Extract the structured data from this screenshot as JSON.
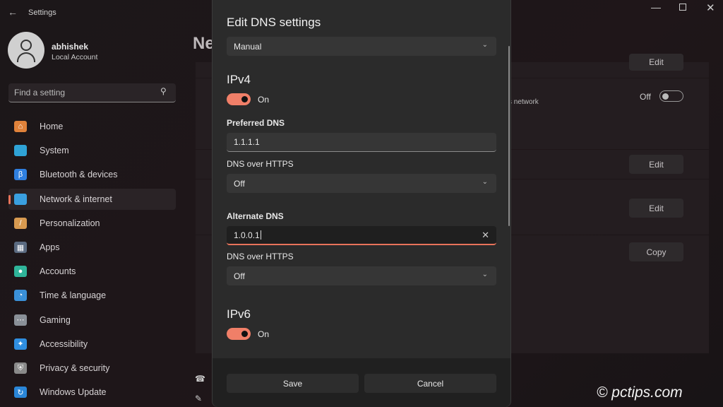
{
  "window": {
    "title": "Settings",
    "controls": [
      "minimize",
      "maximize",
      "close"
    ]
  },
  "profile": {
    "name": "abhishek",
    "account_type": "Local Account"
  },
  "search": {
    "placeholder": "Find a setting"
  },
  "sidebar": {
    "items": [
      {
        "label": "Home",
        "icon": "home-icon",
        "color": "#e0823a"
      },
      {
        "label": "System",
        "icon": "monitor-icon",
        "color": "#2fa3d6"
      },
      {
        "label": "Bluetooth & devices",
        "icon": "bluetooth-icon",
        "color": "#2f7fe0"
      },
      {
        "label": "Network & internet",
        "icon": "wifi-icon",
        "color": "#3aa0e0",
        "selected": true
      },
      {
        "label": "Personalization",
        "icon": "brush-icon",
        "color": "#d89a50"
      },
      {
        "label": "Apps",
        "icon": "apps-icon",
        "color": "#5a6a80"
      },
      {
        "label": "Accounts",
        "icon": "person-icon",
        "color": "#2fb59a"
      },
      {
        "label": "Time & language",
        "icon": "globe-clock-icon",
        "color": "#3a90d8"
      },
      {
        "label": "Gaming",
        "icon": "gamepad-icon",
        "color": "#8a9098"
      },
      {
        "label": "Accessibility",
        "icon": "accessibility-icon",
        "color": "#2f8ee0"
      },
      {
        "label": "Privacy & security",
        "icon": "shield-icon",
        "color": "#8a8a8a"
      },
      {
        "label": "Windows Update",
        "icon": "update-icon",
        "color": "#2a86d8"
      }
    ]
  },
  "background": {
    "page_title_partial": "Ne",
    "row_text_partial": "s network",
    "toggle_label": "Off",
    "buttons": [
      "Edit",
      "Edit",
      "Edit",
      "Copy"
    ]
  },
  "dialog": {
    "title": "Edit DNS settings",
    "mode": "Manual",
    "ipv4": {
      "heading": "IPv4",
      "toggle": "On",
      "preferred_label": "Preferred DNS",
      "preferred_value": "1.1.1.1",
      "doh_label_1": "DNS over HTTPS",
      "doh_value_1": "Off",
      "alternate_label": "Alternate DNS",
      "alternate_value": "1.0.0.1",
      "doh_label_2": "DNS over HTTPS",
      "doh_value_2": "Off"
    },
    "ipv6": {
      "heading": "IPv6",
      "toggle": "On"
    },
    "save": "Save",
    "cancel": "Cancel"
  },
  "accent": "#f07f68",
  "watermark": "© pctips.com"
}
